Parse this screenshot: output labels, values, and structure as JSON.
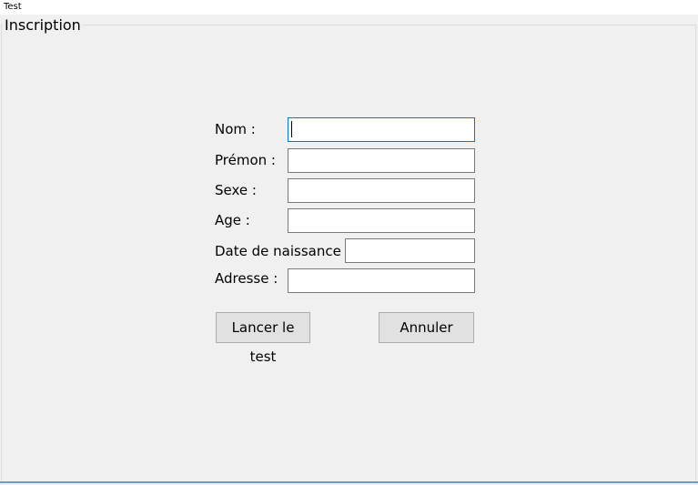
{
  "window": {
    "title": "Test"
  },
  "group": {
    "label": "Inscription"
  },
  "form": {
    "nom": {
      "label": "Nom :",
      "value": ""
    },
    "prenom": {
      "label": "Prémon :",
      "value": ""
    },
    "sexe": {
      "label": "Sexe :",
      "value": ""
    },
    "age": {
      "label": "Age :",
      "value": ""
    },
    "date_naissance": {
      "label": "Date de naissance :",
      "value": ""
    },
    "adresse": {
      "label": "Adresse :",
      "value": ""
    }
  },
  "buttons": {
    "start": "Lancer le test",
    "cancel": "Annuler"
  },
  "colors": {
    "background": "#f0f0f0",
    "focus_border": "#0078d7",
    "bottom_accent": "#6d9ac8"
  }
}
